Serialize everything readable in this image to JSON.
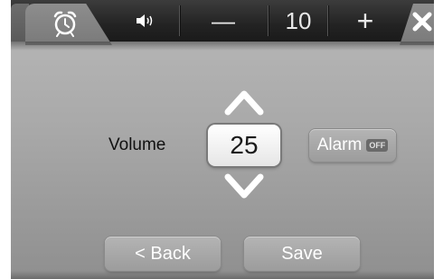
{
  "topbar": {
    "alarm_tab_icon": "alarm-clock-icon",
    "speaker_icon": "speaker-icon",
    "minus_label": "—",
    "value": "10",
    "plus_label": "+",
    "close_icon": "close-x-icon"
  },
  "main": {
    "volume_label": "Volume",
    "volume_value": "25",
    "up_icon": "chevron-up-icon",
    "down_icon": "chevron-down-icon",
    "alarm_button_label": "Alarm",
    "alarm_state": "OFF"
  },
  "footer": {
    "back_label": "< Back",
    "save_label": "Save"
  }
}
